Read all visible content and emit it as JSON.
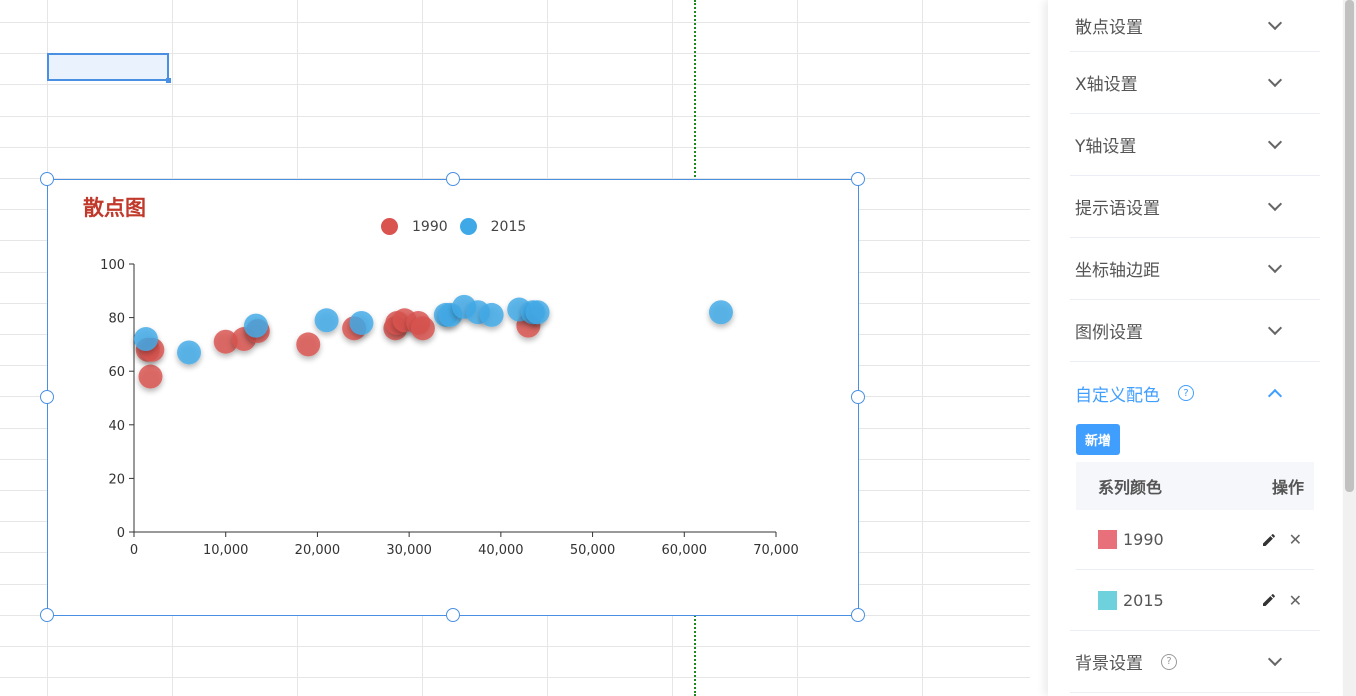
{
  "chart": {
    "title": "散点图"
  },
  "chart_data": {
    "type": "scatter",
    "title": "散点图",
    "xlabel": "",
    "ylabel": "",
    "xlim": [
      0,
      70000
    ],
    "ylim": [
      0,
      100
    ],
    "x_ticks": [
      "0",
      "10,000",
      "20,000",
      "30,000",
      "40,000",
      "50,000",
      "60,000",
      "70,000"
    ],
    "y_ticks": [
      "0",
      "20",
      "40",
      "60",
      "80",
      "100"
    ],
    "legend": "top-center",
    "series": [
      {
        "name": "1990",
        "color": "#d9534f",
        "points": [
          [
            1500,
            68
          ],
          [
            1800,
            58
          ],
          [
            2000,
            68
          ],
          [
            10000,
            71
          ],
          [
            12000,
            72
          ],
          [
            13500,
            75
          ],
          [
            19000,
            70
          ],
          [
            24000,
            76
          ],
          [
            28500,
            76
          ],
          [
            28700,
            78
          ],
          [
            29500,
            79
          ],
          [
            31000,
            78
          ],
          [
            31500,
            76
          ],
          [
            43000,
            77
          ]
        ]
      },
      {
        "name": "2015",
        "color": "#3fa9e8",
        "points": [
          [
            1300,
            72
          ],
          [
            6000,
            67
          ],
          [
            13300,
            77
          ],
          [
            21000,
            79
          ],
          [
            24800,
            78
          ],
          [
            34000,
            81
          ],
          [
            34500,
            81
          ],
          [
            36000,
            84
          ],
          [
            37500,
            82
          ],
          [
            39000,
            81
          ],
          [
            42000,
            83
          ],
          [
            43500,
            82
          ],
          [
            44000,
            82
          ],
          [
            64000,
            82
          ]
        ]
      }
    ]
  },
  "panel": {
    "sections": [
      {
        "label": "散点设置"
      },
      {
        "label": "X轴设置"
      },
      {
        "label": "Y轴设置"
      },
      {
        "label": "提示语设置"
      },
      {
        "label": "坐标轴边距"
      },
      {
        "label": "图例设置"
      }
    ],
    "custom_color": {
      "label": "自定义配色",
      "help": "?",
      "add_label": "新增",
      "head_color": "系列颜色",
      "head_ops": "操作",
      "rows": [
        {
          "name": "1990",
          "color": "#e8707a"
        },
        {
          "name": "2015",
          "color": "#6fd1dc"
        }
      ]
    },
    "background": {
      "label": "背景设置",
      "help": "?"
    }
  },
  "icons": {
    "edit": "pencil-icon",
    "delete": "close-icon",
    "collapse": "chevron-down-icon",
    "expand": "chevron-up-icon"
  }
}
